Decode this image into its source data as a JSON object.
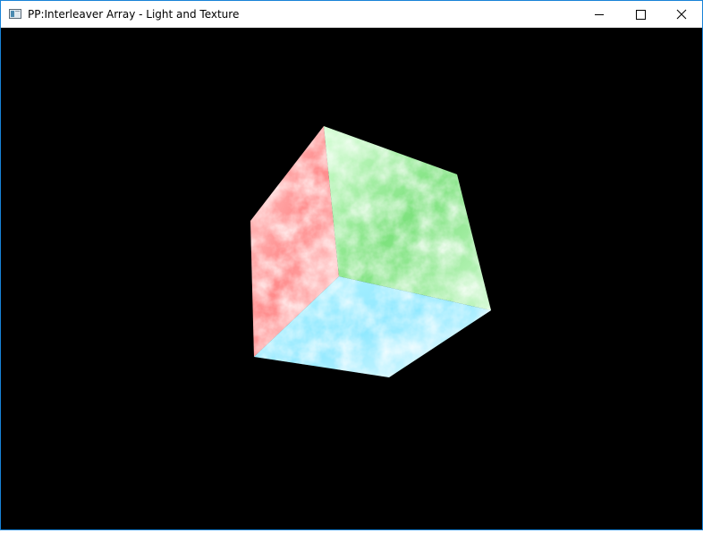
{
  "window": {
    "title": "PP:Interleaver Array - Light and Texture",
    "border_color": "#1883d7",
    "titlebar_color": "#ffffff",
    "controls": [
      {
        "name": "minimize",
        "icon": "minimize-icon"
      },
      {
        "name": "maximize",
        "icon": "maximize-icon"
      },
      {
        "name": "close",
        "icon": "close-icon"
      }
    ]
  },
  "scene": {
    "background": "#000000",
    "object": "textured-cube",
    "faces": [
      {
        "name": "red-face",
        "tint": "#ff7070"
      },
      {
        "name": "green-face",
        "tint": "#50e050"
      },
      {
        "name": "cyan-face",
        "tint": "#50e0ff"
      }
    ]
  }
}
